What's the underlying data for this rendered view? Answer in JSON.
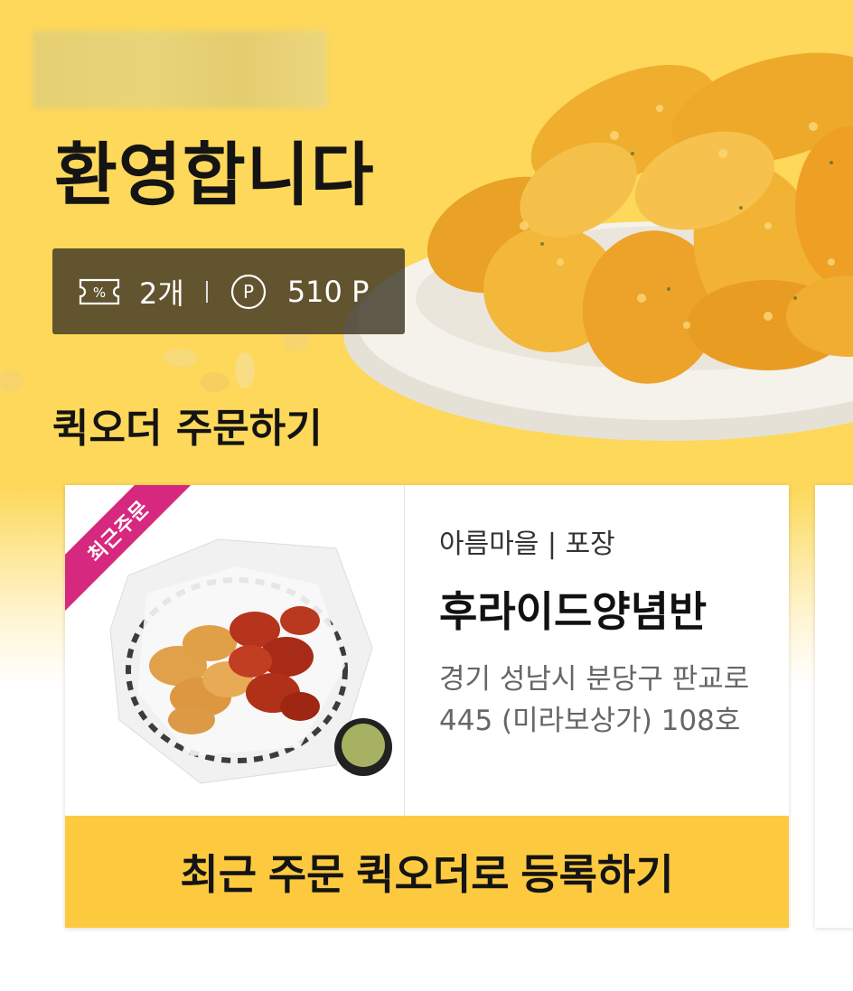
{
  "hero": {
    "greeting": "환영합니다",
    "coupon_count": "2개",
    "point_value": "510 P",
    "quick_order_title": "퀵오더 주문하기"
  },
  "recent_order_card": {
    "badge": "최근주문",
    "store_line": "아름마을 | 포장",
    "menu_name": "후라이드양념반",
    "address": "경기 성남시 분당구 판교로 445 (미라보상가) 108호",
    "register_button": "최근 주문 퀵오더로 등록하기"
  },
  "icons": [
    "coupon-icon",
    "point-icon"
  ],
  "colors": {
    "hero_yellow": "#fdd85a",
    "button_yellow": "#fdca3f",
    "badge_pink": "#d6287e",
    "stats_bg": "#3e3726"
  }
}
